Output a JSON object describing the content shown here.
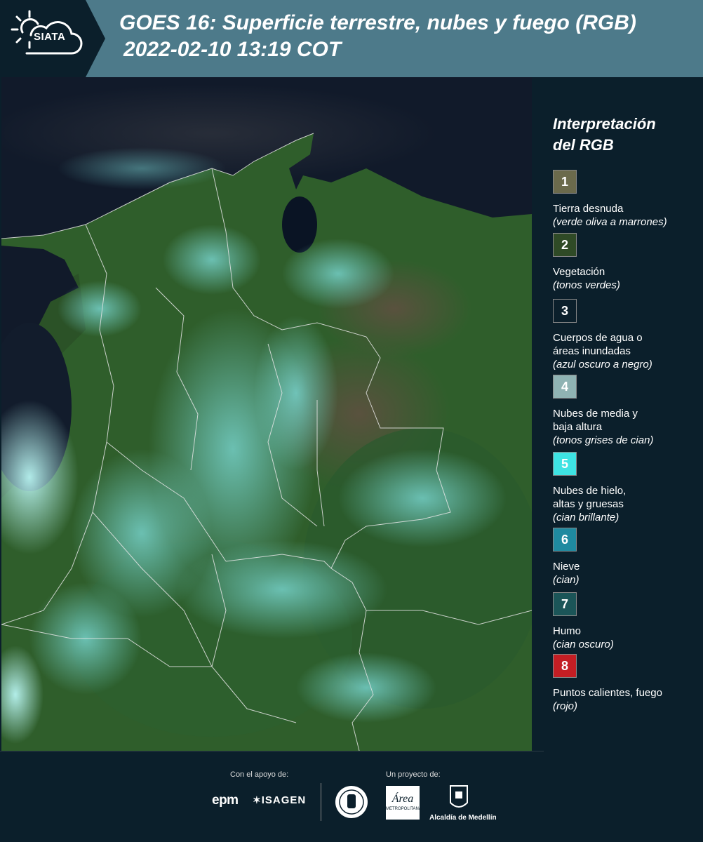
{
  "header": {
    "logo_text": "SIATA",
    "title_line1": "GOES 16: Superficie terrestre, nubes y fuego (RGB)",
    "title_line2": "2022-02-10 13:19 COT"
  },
  "legend": {
    "heading_line1": "Interpretación",
    "heading_line2": "del RGB",
    "items": [
      {
        "num": "1",
        "color": "#6b6a4c",
        "name": "Tierra desnuda",
        "name2": "",
        "desc": "(verde oliva a marrones)"
      },
      {
        "num": "2",
        "color": "#2f4a26",
        "name": "Vegetación",
        "name2": "",
        "desc": "(tonos verdes)"
      },
      {
        "num": "3",
        "color": "#0b1f2b",
        "name": "Cuerpos de agua o",
        "name2": "áreas inundadas",
        "desc": "(azul oscuro a negro)"
      },
      {
        "num": "4",
        "color": "#8fb3b3",
        "name": "Nubes de media y",
        "name2": "baja altura",
        "desc": "(tonos grises de cian)"
      },
      {
        "num": "5",
        "color": "#3ee3e3",
        "name": "Nubes de hielo,",
        "name2": "altas y gruesas",
        "desc": "(cian brillante)"
      },
      {
        "num": "6",
        "color": "#1f8aa0",
        "name": "Nieve",
        "name2": "",
        "desc": "(cian)"
      },
      {
        "num": "7",
        "color": "#1b5558",
        "name": "Humo",
        "name2": "",
        "desc": "(cian oscuro)"
      },
      {
        "num": "8",
        "color": "#c41e24",
        "name": "Puntos calientes, fuego",
        "name2": "",
        "desc": "(rojo)"
      }
    ]
  },
  "footer": {
    "support_label": "Con el apoyo de:",
    "project_label": "Un proyecto de:",
    "epm": "epm",
    "isagen": "ISAGEN",
    "area_text": "Área",
    "area_sub": "METROPOLITANA",
    "alcaldia": "Alcaldía de Medellín"
  }
}
